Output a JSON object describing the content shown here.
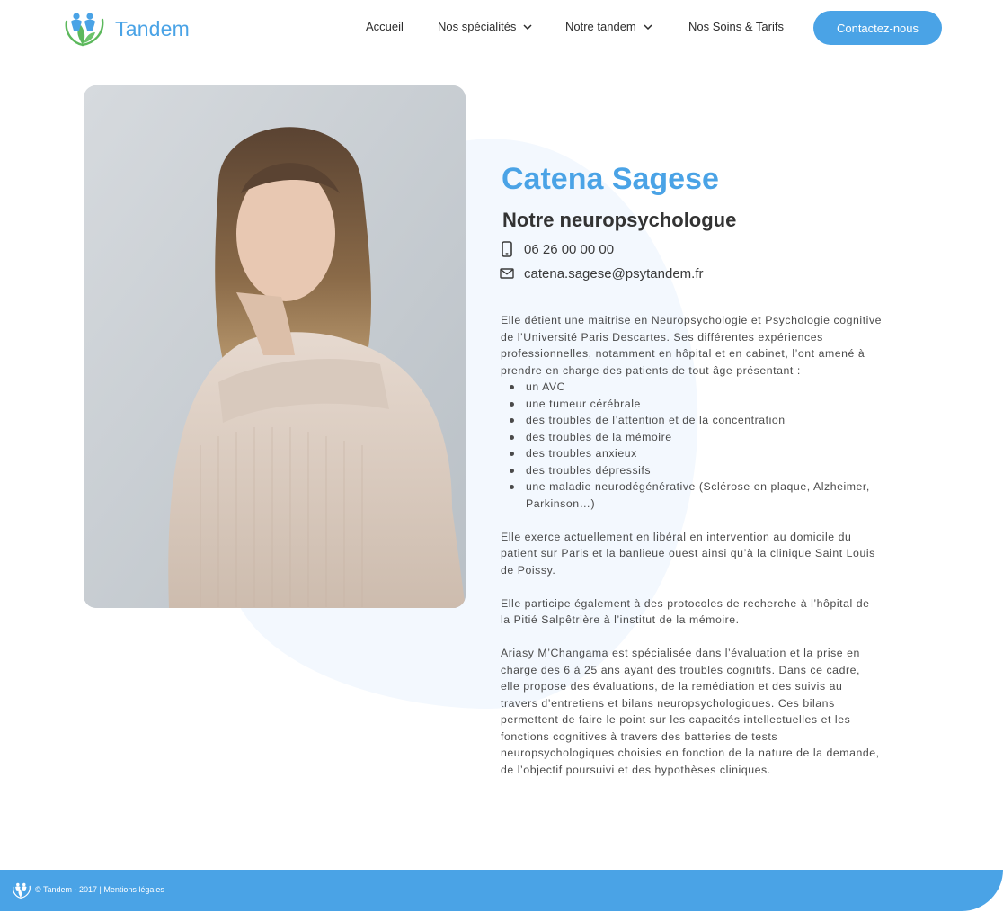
{
  "header": {
    "brand": "Tandem",
    "nav": {
      "home": "Accueil",
      "specialties": "Nos spécialités",
      "team": "Notre tandem",
      "pricing": "Nos Soins & Tarifs"
    },
    "cta_label": "Contactez-nous"
  },
  "profile": {
    "name": "Catena Sagese",
    "role": "Notre neuropsychologue",
    "phone": "06 26 00 00  00",
    "email": "catena.sagese@psytandem.fr",
    "icons": {
      "phone": "mobile-phone-icon",
      "email": "envelope-icon"
    }
  },
  "bio": {
    "intro": "Elle détient une maitrise en Neuropsychologie et Psychologie cognitive de l’Université Paris Descartes. Ses différentes expériences professionnelles, notamment en hôpital et en cabinet, l’ont amené à prendre en charge des patients de tout âge présentant :",
    "conditions": [
      "un AVC",
      "une tumeur cérébrale",
      "des troubles de l’attention et de la concentration",
      "des troubles de la mémoire",
      "des troubles anxieux",
      "des troubles dépressifs",
      "une maladie neurodégénérative (Sclérose en plaque, Alzheimer, Parkinson…)"
    ],
    "paragraph_2": "Elle exerce actuellement en libéral en intervention au domicile du patient sur Paris et la banlieue ouest ainsi qu’à la clinique Saint Louis de Poissy.",
    "paragraph_3": "Elle participe également à des protocoles de recherche à l’hôpital de la Pitié Salpêtrière à l’institut de la mémoire.",
    "paragraph_4": "Ariasy M’Changama est spécialisée dans l’évaluation et la prise en charge des 6 à 25 ans ayant des troubles cognitifs. Dans ce cadre, elle propose des évaluations, de la remédiation et des suivis au travers d’entretiens et bilans neuropsychologiques. Ces bilans permettent de faire le point sur les capacités intellectuelles et les fonctions cognitives à travers des batteries de tests neuropsychologiques choisies en fonction de la nature de la demande, de l’objectif poursuivi et des hypothèses cliniques."
  },
  "footer": {
    "copyright": "© Tandem - 2017 |",
    "legal_link": "Mentions légales"
  },
  "colors": {
    "accent": "#4aa3e6",
    "logo_green": "#5cb85c",
    "text": "#4a4a4a",
    "blob": "#f3f8fe"
  }
}
